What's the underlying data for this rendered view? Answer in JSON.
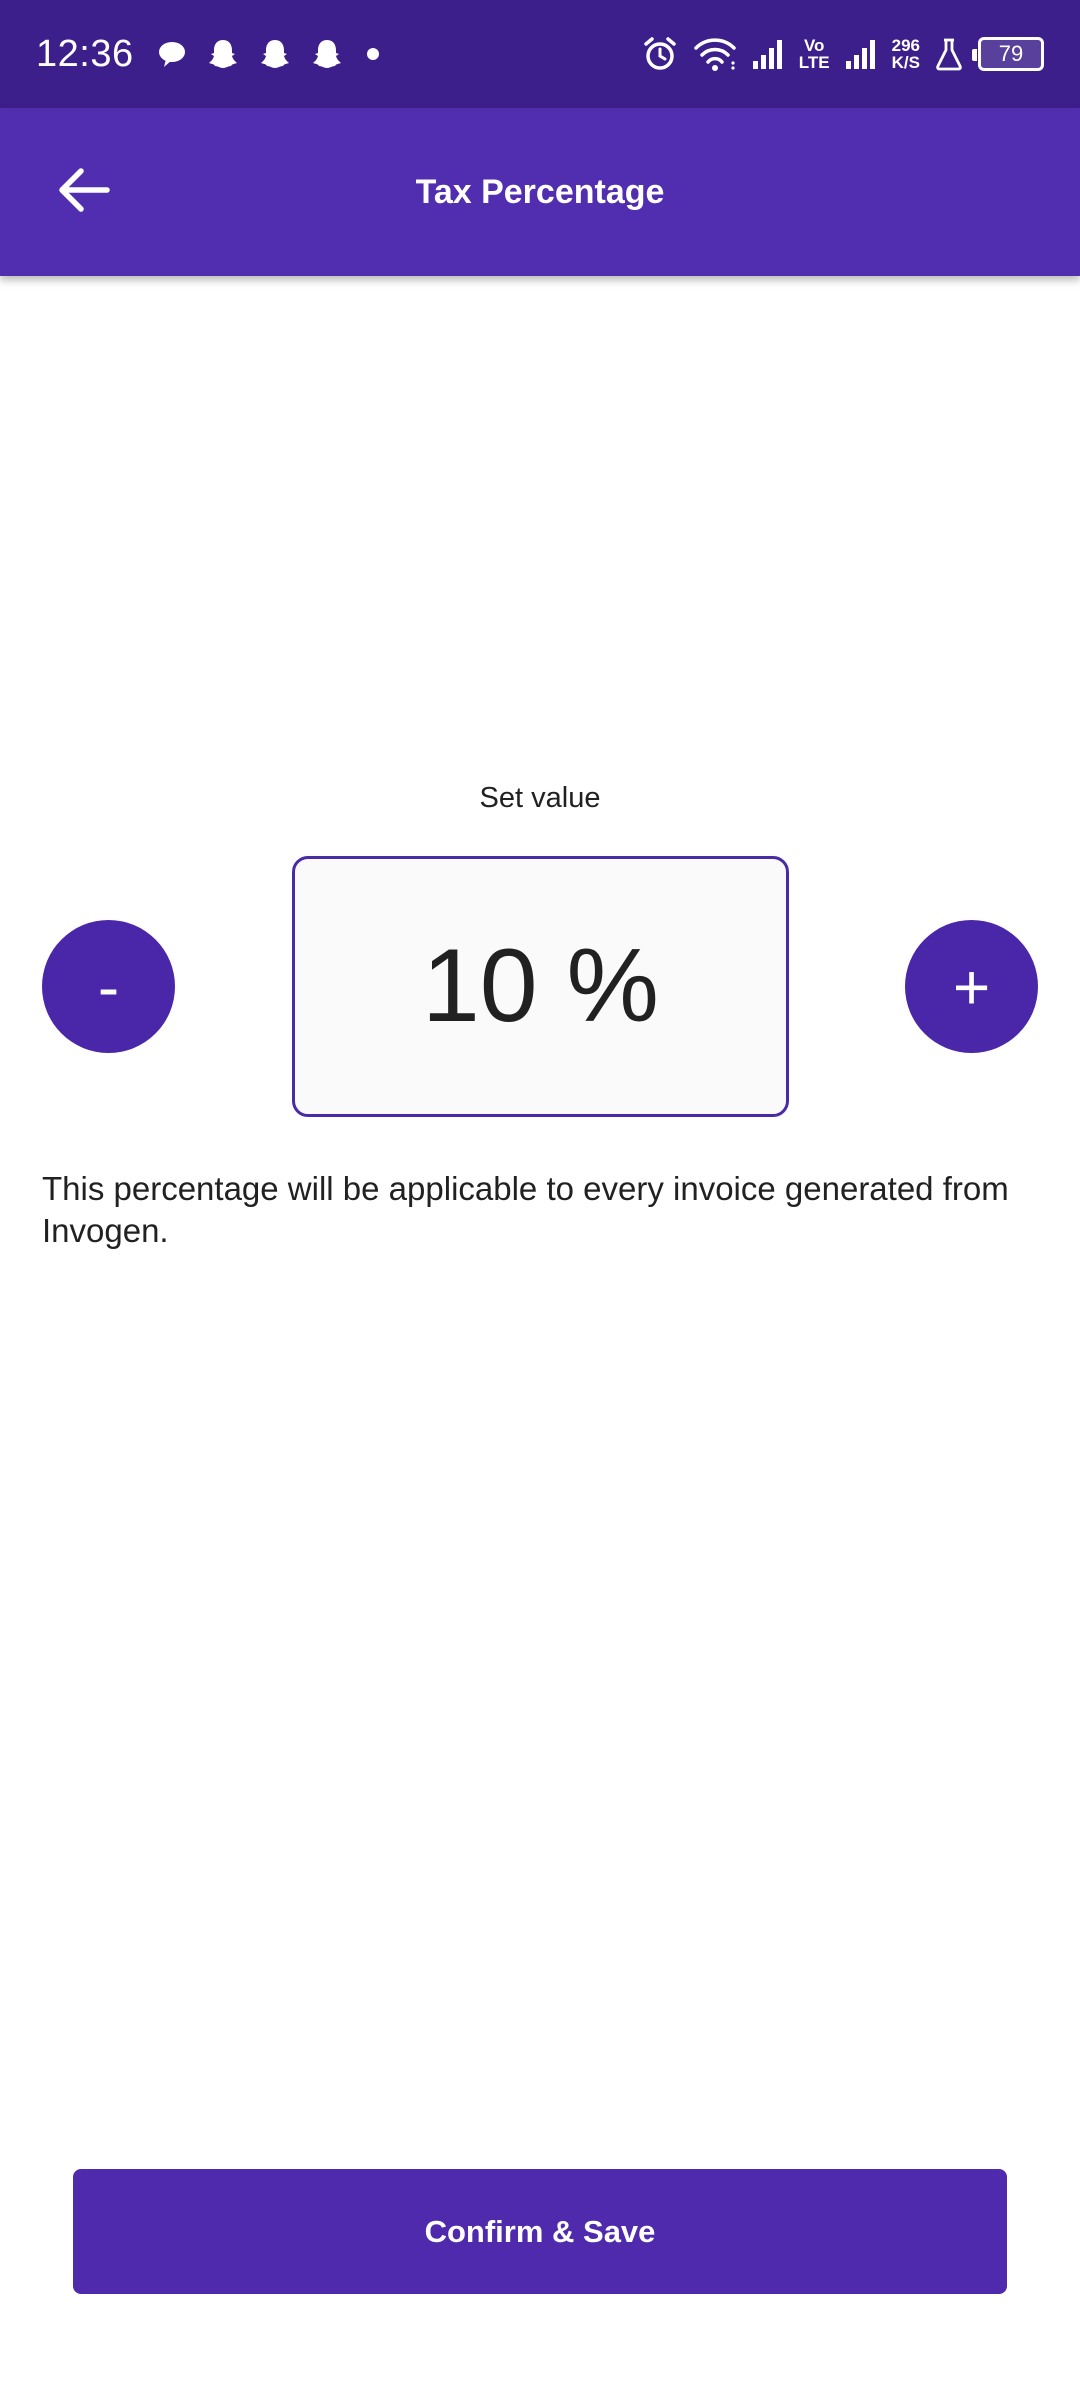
{
  "status_bar": {
    "time": "12:36",
    "left_icons": [
      "chat-bubble-icon",
      "snapchat-icon",
      "snapchat-icon",
      "snapchat-icon",
      "dot-icon"
    ],
    "volte_top": "Vo",
    "volte_bottom": "LTE",
    "speed_value": "296",
    "speed_unit": "K/S",
    "battery": "79"
  },
  "app_bar": {
    "title": "Tax Percentage",
    "back_icon": "arrow-left-icon"
  },
  "editor": {
    "label": "Set value",
    "value": "10 %",
    "minus_label": "-",
    "plus_label": "+"
  },
  "info": {
    "text": "This percentage will be applicable to every invoice generated from Invogen."
  },
  "footer": {
    "confirm_label": "Confirm & Save"
  },
  "colors": {
    "status_bar": "#3d1f8c",
    "app_bar": "#512db0",
    "accent": "#4a26a8",
    "button": "#4f2aac"
  }
}
